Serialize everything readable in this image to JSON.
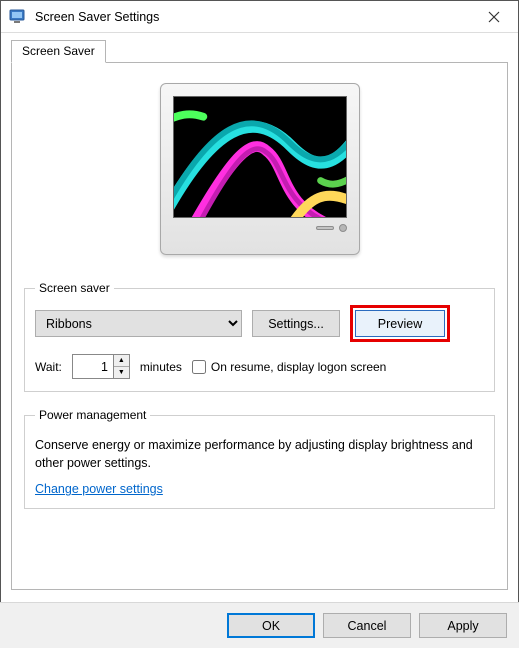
{
  "window": {
    "title": "Screen Saver Settings"
  },
  "tab": {
    "label": "Screen Saver"
  },
  "screensaver": {
    "legend": "Screen saver",
    "selected": "Ribbons",
    "settings_btn": "Settings...",
    "preview_btn": "Preview",
    "wait_label": "Wait:",
    "wait_value": "1",
    "wait_unit": "minutes",
    "resume_label": "On resume, display logon screen",
    "resume_checked": false
  },
  "power": {
    "legend": "Power management",
    "text": "Conserve energy or maximize performance by adjusting display brightness and other power settings.",
    "link": "Change power settings"
  },
  "footer": {
    "ok": "OK",
    "cancel": "Cancel",
    "apply": "Apply"
  }
}
